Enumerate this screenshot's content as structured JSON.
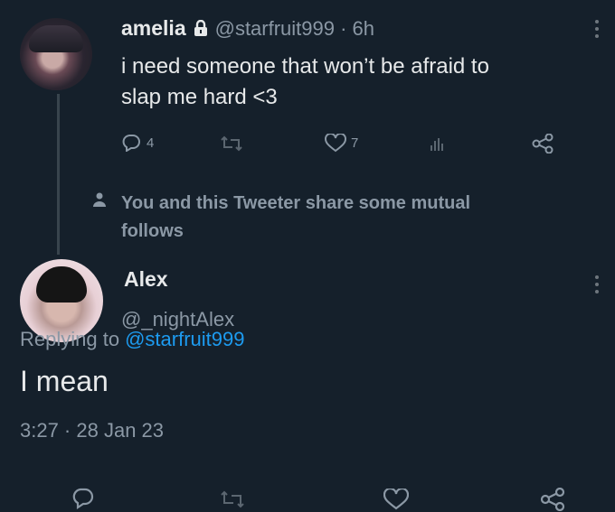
{
  "tweet1": {
    "display_name": "amelia",
    "handle_time": "@starfruit999 · 6h",
    "text_line1": "i need someone that won’t be afraid to",
    "text_line2": "slap me hard <3",
    "reply_count": "4",
    "like_count": "7"
  },
  "mutual_notice": {
    "line1": "You and this Tweeter share some mutual",
    "line2": "follows"
  },
  "tweet2": {
    "display_name": "Alex",
    "handle": "@_nightAlex",
    "replying_prefix": "Replying to",
    "replying_handle": "@starfruit999",
    "text": "I mean",
    "timestamp": "3:27 · 28 Jan 23"
  },
  "colors": {
    "background": "#15202b",
    "accent": "#1d9bf0",
    "muted": "#8b98a5"
  }
}
